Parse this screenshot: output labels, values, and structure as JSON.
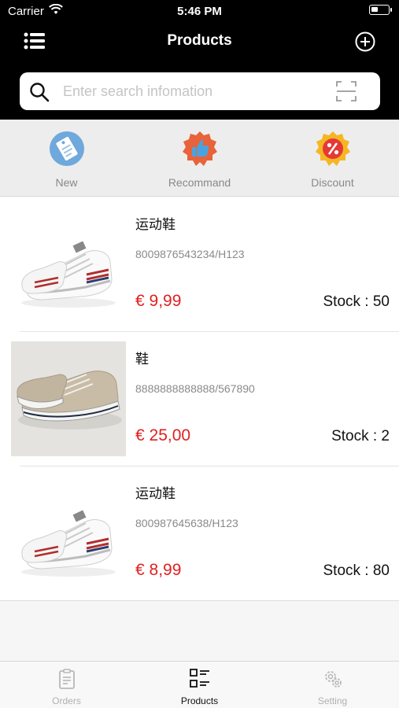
{
  "status_bar": {
    "carrier": "Carrier",
    "time": "5:46 PM"
  },
  "navbar": {
    "title": "Products",
    "left_icon": "list-menu-icon",
    "right_icon": "add-circle-icon"
  },
  "search": {
    "placeholder": "Enter search infomation",
    "value": "",
    "left_icon": "search-icon",
    "right_icon": "scan-icon"
  },
  "categories": [
    {
      "label": "New",
      "icon": "new-tag-icon"
    },
    {
      "label": "Recommand",
      "icon": "thumbs-up-badge-icon"
    },
    {
      "label": "Discount",
      "icon": "percent-badge-icon"
    }
  ],
  "products": [
    {
      "name": "运动鞋",
      "code": "8009876543234/H123",
      "price": "€ 9,99",
      "stock": "Stock : 50"
    },
    {
      "name": "鞋",
      "code": "8888888888888/567890",
      "price": "€ 25,00",
      "stock": "Stock : 2"
    },
    {
      "name": "运动鞋",
      "code": "800987645638/H123",
      "price": "€ 8,99",
      "stock": "Stock : 80"
    }
  ],
  "tabs": [
    {
      "label": "Orders",
      "icon": "clipboard-icon",
      "active": false
    },
    {
      "label": "Products",
      "icon": "product-list-icon",
      "active": true
    },
    {
      "label": "Setting",
      "icon": "gears-icon",
      "active": false
    }
  ],
  "colors": {
    "accent_price": "#e02020",
    "header_bg": "#000000"
  }
}
